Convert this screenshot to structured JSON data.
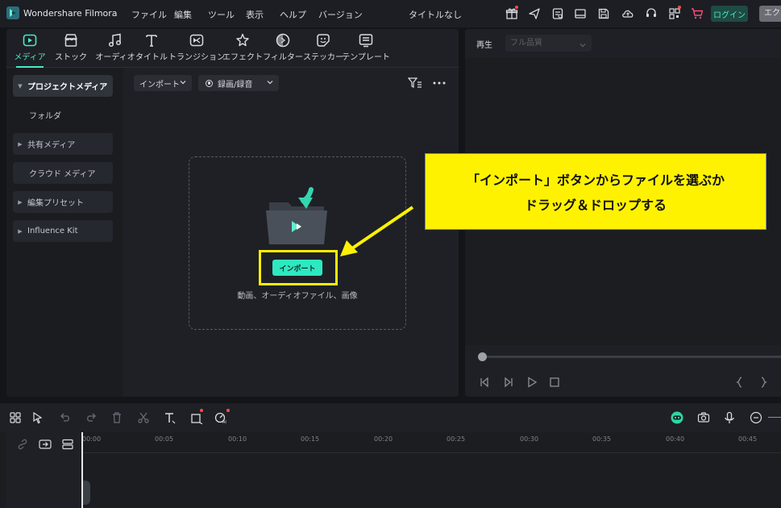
{
  "titlebar": {
    "app_name": "Wondershare Filmora",
    "menu": [
      "ファイル",
      "編集",
      "ツール",
      "表示",
      "ヘルプ",
      "バージョン"
    ],
    "doc_title": "タイトルなし",
    "login_label": "ログイン",
    "export_label": "エクスポート",
    "icons": [
      "gift-icon",
      "send-icon",
      "report-icon",
      "layout-icon",
      "save-icon",
      "cloud-upload-icon",
      "support-icon",
      "qr-icon",
      "cart-icon"
    ]
  },
  "tool_tabs": [
    {
      "label": "メディア",
      "icon": "media-icon",
      "active": true
    },
    {
      "label": "ストック",
      "icon": "stock-icon"
    },
    {
      "label": "オーディオ",
      "icon": "audio-icon"
    },
    {
      "label": "タイトル",
      "icon": "title-icon"
    },
    {
      "label": "トランジション",
      "icon": "transition-icon"
    },
    {
      "label": "エフェクト",
      "icon": "effect-icon"
    },
    {
      "label": "フィルター",
      "icon": "filter-icon"
    },
    {
      "label": "ステッカー",
      "icon": "sticker-icon"
    },
    {
      "label": "テンプレート",
      "icon": "template-icon"
    }
  ],
  "side_nav": [
    {
      "label": "プロジェクトメディア",
      "expandable": true,
      "active": true
    },
    {
      "label": "フォルダ",
      "expandable": false
    },
    {
      "label": "共有メディア",
      "expandable": true
    },
    {
      "label": "クラウド メディア",
      "expandable": false
    },
    {
      "label": "編集プリセット",
      "expandable": true
    },
    {
      "label": "Influence Kit",
      "expandable": true
    }
  ],
  "media_toolbar": {
    "import_label": "インポート",
    "record_label": "録画/録音"
  },
  "drop_zone": {
    "import_button": "インポート",
    "hint": "動画、オーディオファイル、画像"
  },
  "player": {
    "label": "再生",
    "quality": "フル品質",
    "progress": 0
  },
  "annotation": {
    "line1": "「インポート」ボタンからファイルを選ぶか",
    "line2": "ドラッグ＆ドロップする"
  },
  "timeline": {
    "ticks": [
      "00:00",
      "00:05",
      "00:10",
      "00:15",
      "00:20",
      "00:25",
      "00:30",
      "00:35",
      "00:40",
      "00:45"
    ]
  },
  "colors": {
    "accent": "#4ee6c4",
    "import_button": "#2ee8c0",
    "highlight": "#fff200"
  }
}
